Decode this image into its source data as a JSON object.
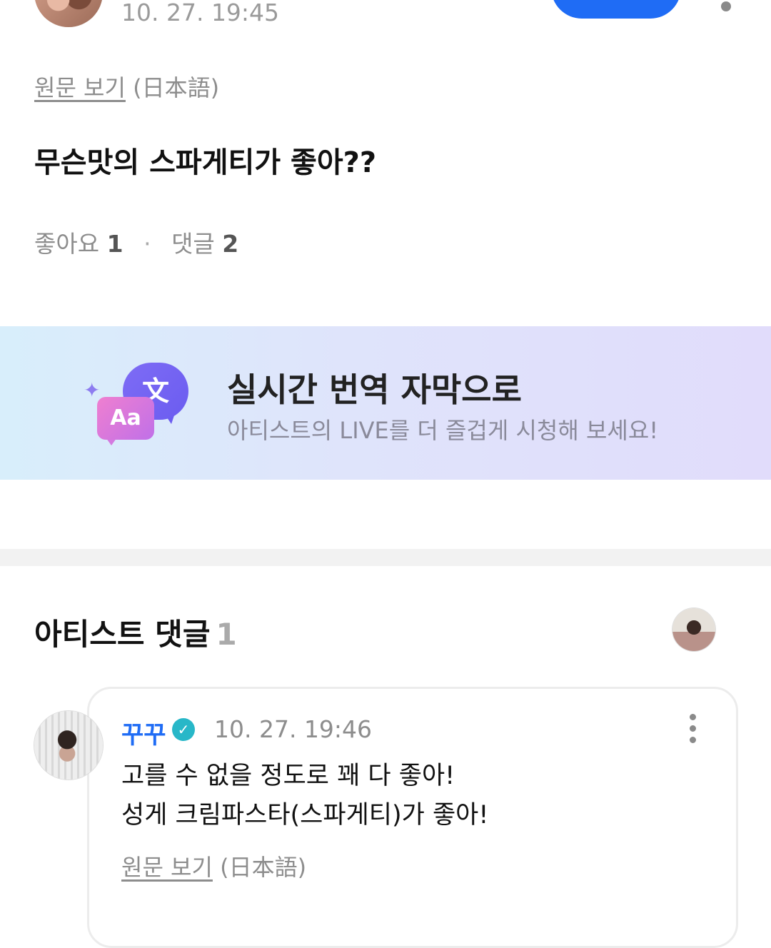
{
  "post": {
    "time": "10. 27. 19:45",
    "view_original_label": "원문 보기",
    "original_language": "(日本語)",
    "text": "무슨맛의 스파게티가 좋아??",
    "likes_label": "좋아요",
    "likes_count": "1",
    "comments_label": "댓글",
    "comments_count": "2"
  },
  "banner": {
    "title": "실시간 번역 자막으로",
    "subtitle": "아티스트의 LIVE를 더 즐겁게 시청해 보세요!",
    "icon_aa": "Aa",
    "icon_wen": "文"
  },
  "artist_comments": {
    "title": "아티스트 댓글",
    "count": "1"
  },
  "comment": {
    "author": "꾸꾸",
    "time": "10. 27. 19:46",
    "line1": "고를 수 없을 정도로 꽤 다 좋아!",
    "line2": "성게 크림파스타(스파게티)가 좋아!",
    "view_original_label": "원문 보기",
    "original_language": "(日本語)"
  },
  "colors": {
    "accent": "#1f6cf5",
    "verified": "#28b7c8",
    "muted": "#8d8d8d"
  }
}
